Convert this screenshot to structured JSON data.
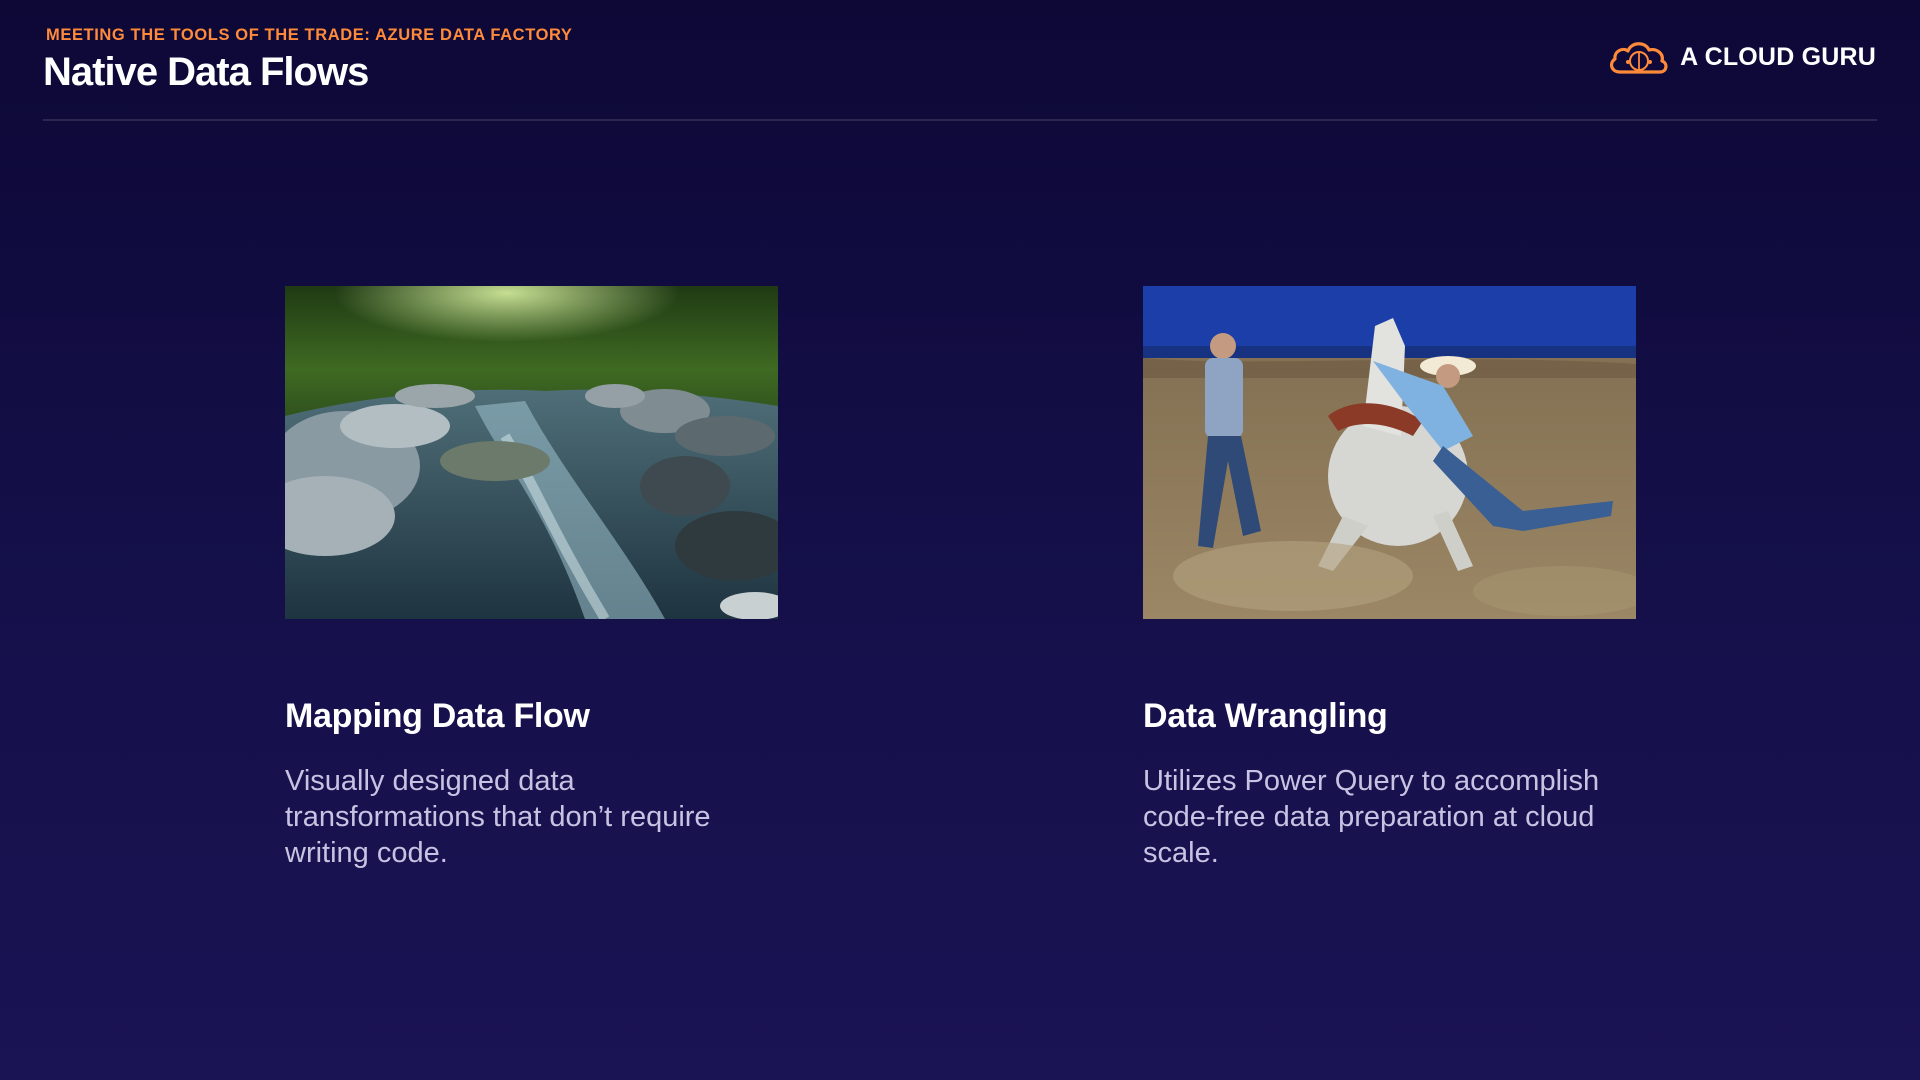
{
  "header": {
    "eyebrow": "MEETING THE TOOLS OF THE TRADE: AZURE DATA FACTORY",
    "title": "Native Data Flows"
  },
  "logo": {
    "text": "A CLOUD GURU",
    "icon": "cloud-logo-icon",
    "accent_color": "#ff8a3a"
  },
  "cards": [
    {
      "image": "river-stream-photo",
      "title": "Mapping Data Flow",
      "body": "Visually designed data transformations that don’t require writing code."
    },
    {
      "image": "horse-wrangling-photo",
      "title": "Data Wrangling",
      "body": "Utilizes Power Query to accomplish code-free data preparation at cloud scale."
    }
  ]
}
